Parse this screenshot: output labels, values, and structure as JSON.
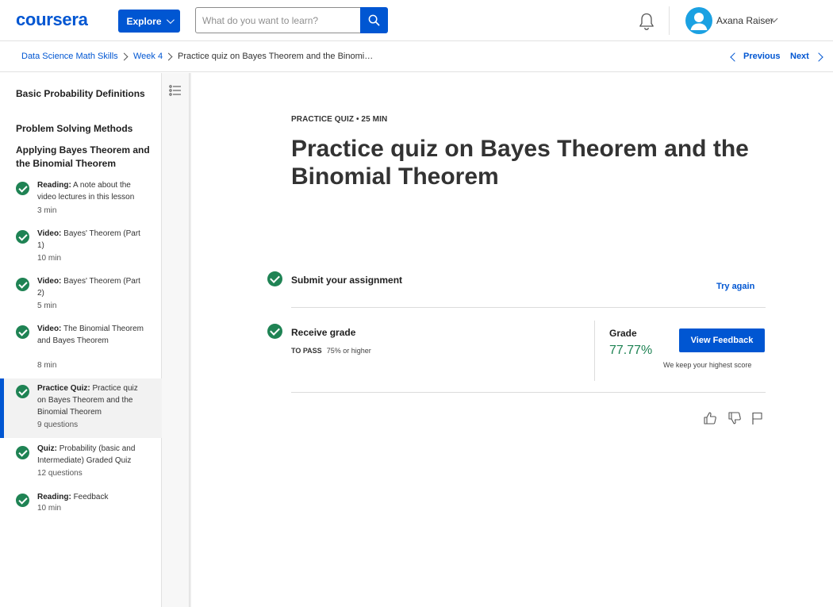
{
  "header": {
    "logo": "coursera",
    "explore_label": "Explore",
    "search_placeholder": "What do you want to learn?",
    "user_name": "Axana Raiser"
  },
  "breadcrumb": {
    "items": [
      "Data Science Math Skills",
      "Week 4",
      "Practice quiz on Bayes Theorem and the Binomi…"
    ],
    "prev_label": "Previous",
    "next_label": "Next"
  },
  "sidebar": {
    "sections": [
      "Basic Probability Definitions",
      "Problem Solving Methods",
      "Applying Bayes Theorem and the Binomial Theorem"
    ],
    "items": [
      {
        "type": "Reading:",
        "name": "A note about the video lectures in this lesson",
        "meta": "3 min"
      },
      {
        "type": "Video:",
        "name": "Bayes' Theorem (Part 1)",
        "meta": "10 min"
      },
      {
        "type": "Video:",
        "name": "Bayes' Theorem (Part 2)",
        "meta": "5 min"
      },
      {
        "type": "Video:",
        "name": "The Binomial Theorem and Bayes Theorem",
        "meta": "8 min"
      },
      {
        "type": "Practice Quiz:",
        "name": "Practice quiz on Bayes Theorem and the Binomial Theorem",
        "meta": "9 questions"
      },
      {
        "type": "Quiz:",
        "name": "Probability (basic and Intermediate) Graded Quiz",
        "meta": "12 questions"
      },
      {
        "type": "Reading:",
        "name": "Feedback",
        "meta": "10 min"
      }
    ]
  },
  "main": {
    "eyebrow": "PRACTICE QUIZ • 25 MIN",
    "title": "Practice quiz on Bayes Theorem and the Binomial Theorem",
    "submit_label": "Submit your assignment",
    "try_again": "Try again",
    "receive_label": "Receive grade",
    "to_pass_label": "TO PASS",
    "to_pass_value": "75% or higher",
    "grade_label": "Grade",
    "grade_value": "77.77%",
    "view_feedback": "View Feedback",
    "keep_note": "We keep your highest score"
  },
  "colors": {
    "brand": "#0056d2",
    "success": "#1f8354"
  },
  "icons": [
    "search-icon",
    "bell-icon",
    "avatar-icon",
    "list-icon",
    "check-icon",
    "thumbs-up-icon",
    "thumbs-down-icon",
    "flag-icon"
  ]
}
